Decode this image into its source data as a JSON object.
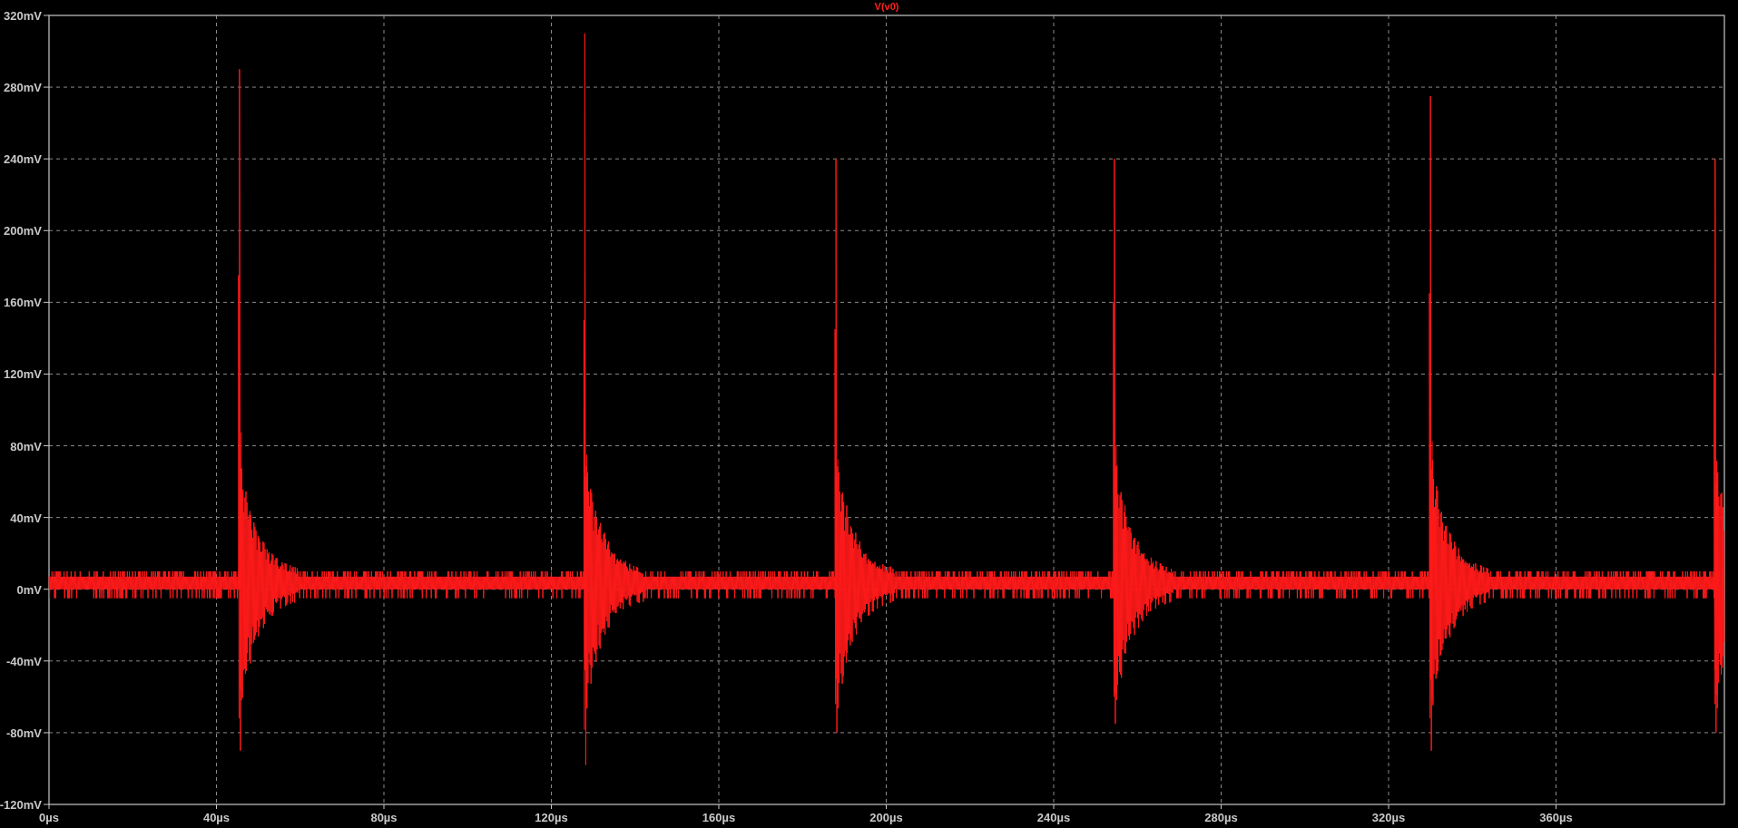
{
  "plot": {
    "title": "V(v0)",
    "y_axis_labels": [
      "320mV",
      "280mV",
      "240mV",
      "200mV",
      "160mV",
      "120mV",
      "80mV",
      "40mV",
      "0mV",
      "-40mV",
      "-80mV",
      "-120mV"
    ],
    "x_axis_labels": [
      "0µs",
      "40µs",
      "80µs",
      "120µs",
      "160µs",
      "200µs",
      "240µs",
      "280µs",
      "320µs",
      "360µs"
    ]
  }
}
